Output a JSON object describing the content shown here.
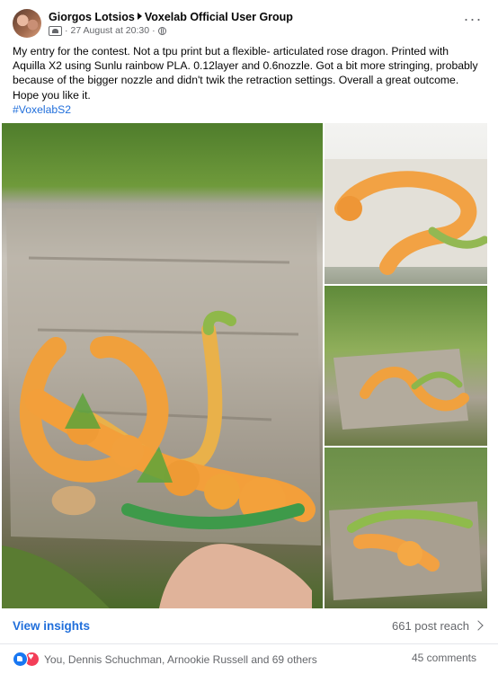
{
  "post": {
    "author": "Giorgos Lotsios",
    "group": "Voxelab Official User Group",
    "timestamp": "27 August at 20:30",
    "more_label": "···",
    "text": "My entry for the contest. Not a tpu print but a flexible- articulated rose dragon. Printed with Aquilla X2 using Sunlu rainbow PLA. 0.12layer and 0.6nozzle. Got a bit more stringing, probably because of the bigger nozzle and didn't twik the retraction settings. Overall a great outcome. Hope you like it.",
    "hashtag": "#VoxelabS2"
  },
  "icons": {
    "avatar": "profile-photo",
    "group": "group-icon",
    "privacy": "globe-icon",
    "more": "more-options-icon",
    "reach_chevron": "chevron-right-icon",
    "like": "like-reaction-icon",
    "love": "love-reaction-icon"
  },
  "footer": {
    "insights_label": "View insights",
    "reach_label": "661 post reach",
    "reactions_text": "You, Dennis Schuchman, Arnookie Russell and 69 others",
    "comments_label": "45 comments"
  },
  "colors": {
    "link_blue": "#216fdb",
    "like_blue": "#1877f2",
    "love_red": "#f33e58",
    "secondary_text": "#65676b"
  }
}
